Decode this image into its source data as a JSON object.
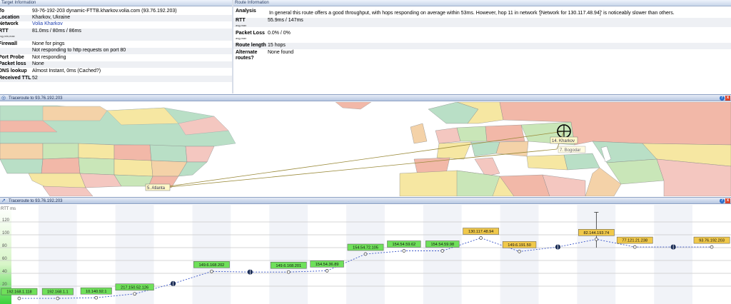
{
  "target": {
    "header": "Target Information",
    "rows": [
      {
        "label": "To",
        "value": "93-76-192-203 dynamic-FTTB.kharkov.volia.com (93.76.192.203)"
      },
      {
        "label": "Location",
        "value": "Kharkov, Ukraine"
      },
      {
        "label": "Network",
        "value": "Volia Kharkov"
      },
      {
        "label": "RTT",
        "value": "81.0ms / 80ms / 86ms",
        "sub": "avg,min,max"
      },
      {
        "label": "Firewall",
        "value": "None for pings"
      },
      {
        "label": "",
        "value": "Not responding to http requests on port 80"
      },
      {
        "label": "Port Probe",
        "value": "Not responding"
      },
      {
        "label": "Packet loss",
        "value": "None"
      },
      {
        "label": "DNS lookup",
        "value": "Almost Instant, 0ms (Cached?)"
      },
      {
        "label": "Received TTL",
        "value": "52"
      }
    ]
  },
  "route": {
    "header": "Route Information",
    "analysis_label": "Analysis",
    "analysis_text": "In general this route offers a good throughput, with hops responding on average within 53ms. However, hop 11 in network '[Network for 130.117.48.94]' is noticeably slower than others.",
    "rtt_label": "RTT",
    "rtt_value": "55.9ms / 147ms",
    "rtt_sub": "avg,max",
    "loss_label": "Packet Loss",
    "loss_value": "0.0% / 0%",
    "loss_sub": "avg,max",
    "length_label": "Route length",
    "length_value": "15 hops",
    "alt_label_1": "Alternate",
    "alt_label_2": "routes?",
    "alt_value": "None found"
  },
  "map_section": {
    "title": "Traceroute to 93.76.192.203",
    "help": "?",
    "close": "x",
    "labels": {
      "atlanta": "5. Atlanta",
      "kharkov": "14. Kharkov",
      "bogodar": "7. Bogodar"
    }
  },
  "chart_section": {
    "title": "Traceroute to 93.76.192.203",
    "help": "?",
    "close": "x"
  },
  "colors": {
    "accent": "#2c6fcc",
    "green": "#6fe05a",
    "yellow": "#f0c84a",
    "line": "#3b56c8"
  },
  "chart_data": {
    "type": "line",
    "ylabel": "RTT ms",
    "yticks": [
      20,
      40,
      60,
      80,
      100,
      120
    ],
    "ylim": [
      0,
      140
    ],
    "grid": true,
    "points": [
      {
        "hop": 1,
        "rtt": 1,
        "label": "192.168.1.118",
        "color": "green"
      },
      {
        "hop": 2,
        "rtt": 1,
        "label": "192.168.1.1",
        "color": "green"
      },
      {
        "hop": 3,
        "rtt": 2,
        "label": "10.140.92.1",
        "color": "green"
      },
      {
        "hop": 4,
        "rtt": 8,
        "label": "217.150.52.126",
        "color": "green"
      },
      {
        "hop": 5,
        "rtt": 24,
        "label": "",
        "color": "none"
      },
      {
        "hop": 6,
        "rtt": 43,
        "label": "149.6.168.202",
        "color": "green"
      },
      {
        "hop": 7,
        "rtt": 42,
        "label": "",
        "color": "none"
      },
      {
        "hop": 8,
        "rtt": 42,
        "label": "149.6.168.201",
        "color": "green"
      },
      {
        "hop": 9,
        "rtt": 44,
        "label": "154.54.36.89",
        "color": "green"
      },
      {
        "hop": 10,
        "rtt": 70,
        "label": "154.54.72.105",
        "color": "green"
      },
      {
        "hop": 11,
        "rtt": 75,
        "label": "154.54.59.62",
        "color": "green"
      },
      {
        "hop": 12,
        "rtt": 75,
        "label": "154.54.59.98",
        "color": "green"
      },
      {
        "hop": 13,
        "rtt": 95,
        "label": "130.117.48.94",
        "color": "yellow"
      },
      {
        "hop": 14,
        "rtt": 74,
        "label": "149.6.191.50",
        "color": "yellow"
      },
      {
        "hop": 15,
        "rtt": 81,
        "label": "",
        "color": "none"
      },
      {
        "hop": 16,
        "rtt": 93,
        "label": "82.144.193.74",
        "color": "yellow"
      },
      {
        "hop": 17,
        "rtt": 81,
        "label": "77.121.21.238",
        "color": "yellow"
      },
      {
        "hop": 18,
        "rtt": 81,
        "label": "",
        "color": "none"
      },
      {
        "hop": 19,
        "rtt": 81,
        "label": "93.76.192.203",
        "color": "yellow"
      }
    ]
  }
}
